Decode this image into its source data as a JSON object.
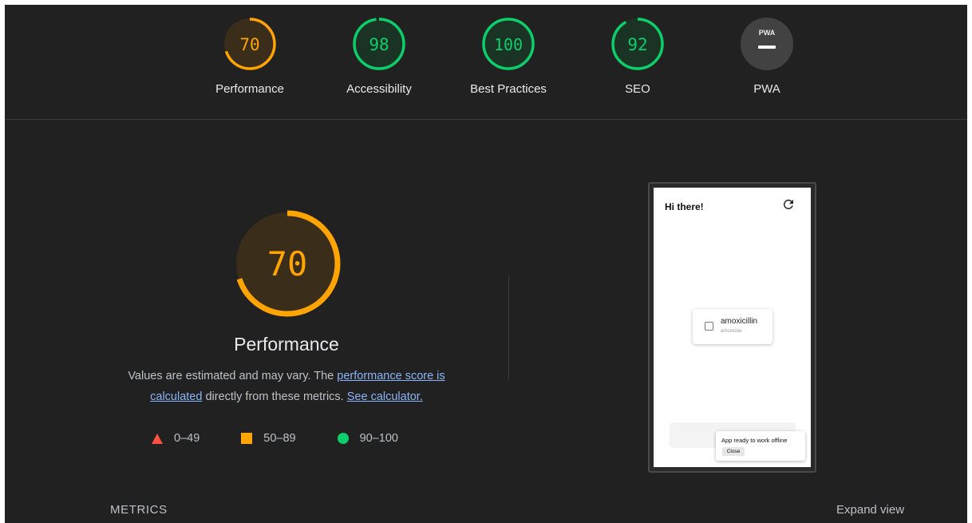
{
  "colors": {
    "background": "#212121",
    "fail": "#ff4e42",
    "average": "#ffa400",
    "pass": "#0cce6b",
    "average_text": "#ffa400",
    "pass_text": "#0cce6b",
    "link": "#8ab4f8",
    "na": "#424242"
  },
  "categories": [
    {
      "label": "Performance",
      "score": "70",
      "value": 70,
      "rating": "average"
    },
    {
      "label": "Accessibility",
      "score": "98",
      "value": 98,
      "rating": "pass"
    },
    {
      "label": "Best Practices",
      "score": "100",
      "value": 100,
      "rating": "pass"
    },
    {
      "label": "SEO",
      "score": "92",
      "value": 92,
      "rating": "pass"
    },
    {
      "label": "PWA",
      "score": "",
      "badge_text": "PWA",
      "rating": "na"
    }
  ],
  "main": {
    "score": "70",
    "value": 70,
    "title": "Performance",
    "desc_part1": "Values are estimated and may vary. The ",
    "desc_link1": "performance score is calculated",
    "desc_part2": " directly from these metrics. ",
    "desc_link2": "See calculator."
  },
  "legend": [
    {
      "shape": "triangle",
      "label": "0–49"
    },
    {
      "shape": "square",
      "label": "50–89"
    },
    {
      "shape": "circle",
      "label": "90–100"
    }
  ],
  "screenshot": {
    "title": "Hi there!",
    "refresh_icon": "refresh-icon",
    "card_title": "amoxicillin",
    "card_subtitle": "amoxiclav",
    "toast_text": "App ready to work offline",
    "toast_button": "Close"
  },
  "footer": {
    "metrics_label": "METRICS",
    "expand_label": "Expand view"
  }
}
